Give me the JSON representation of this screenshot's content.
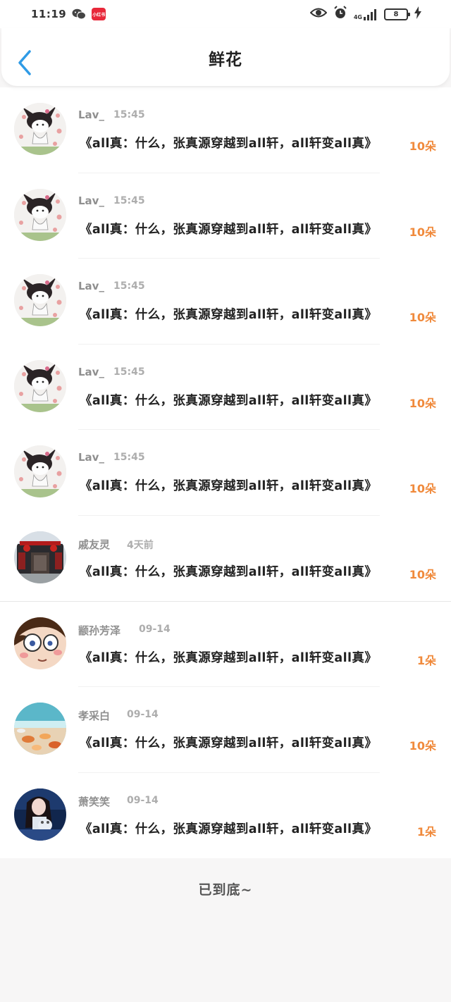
{
  "status_bar": {
    "time": "11:19",
    "app_badge": "小红书",
    "network": "4G",
    "battery": "8"
  },
  "header": {
    "title": "鲜花"
  },
  "items": [
    {
      "name": "Lav_",
      "time": "15:45",
      "text": "《all真：什么，张真源穿越到all轩，all轩变all真》",
      "count": "10朵",
      "avatar": "cat-avatar"
    },
    {
      "name": "Lav_",
      "time": "15:45",
      "text": "《all真：什么，张真源穿越到all轩，all轩变all真》",
      "count": "10朵",
      "avatar": "cat-avatar"
    },
    {
      "name": "Lav_",
      "time": "15:45",
      "text": "《all真：什么，张真源穿越到all轩，all轩变all真》",
      "count": "10朵",
      "avatar": "cat-avatar"
    },
    {
      "name": "Lav_",
      "time": "15:45",
      "text": "《all真：什么，张真源穿越到all轩，all轩变all真》",
      "count": "10朵",
      "avatar": "cat-avatar"
    },
    {
      "name": "Lav_",
      "time": "15:45",
      "text": "《all真：什么，张真源穿越到all轩，all轩变all真》",
      "count": "10朵",
      "avatar": "cat-avatar"
    },
    {
      "name": "戚友灵",
      "time": "4天前",
      "text": "《all真：什么，张真源穿越到all轩，all轩变all真》",
      "count": "10朵",
      "avatar": "building-avatar"
    },
    {
      "name": "颛孙芳泽",
      "time": "09-14",
      "text": "《all真：什么，张真源穿越到all轩，all轩变all真》",
      "count": "1朵",
      "avatar": "cartoon-boy-avatar"
    },
    {
      "name": "孝采白",
      "time": "09-14",
      "text": "《all真：什么，张真源穿越到all轩，all轩变all真》",
      "count": "10朵",
      "avatar": "beach-avatar"
    },
    {
      "name": "萧笑笑",
      "time": "09-14",
      "text": "《all真：什么，张真源穿越到all轩，all轩变all真》",
      "count": "1朵",
      "avatar": "girl-photo-avatar"
    }
  ],
  "footer": {
    "text": "已到底~"
  }
}
